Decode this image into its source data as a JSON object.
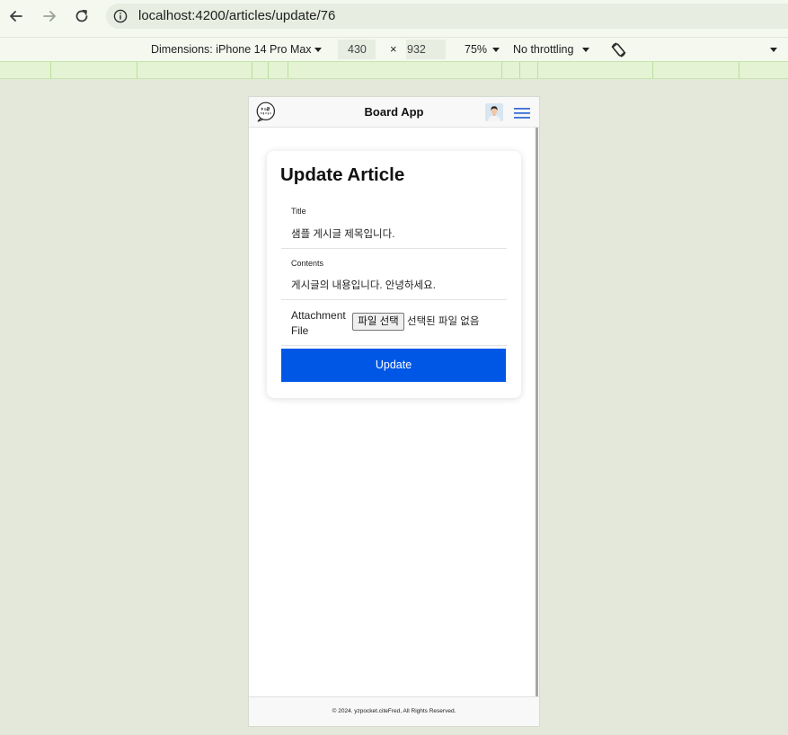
{
  "browser": {
    "back_icon": "arrow-left-icon",
    "forward_icon": "arrow-right-icon",
    "reload_icon": "reload-icon",
    "site_info_icon": "info-icon",
    "url": "localhost:4200/articles/update/76"
  },
  "device_toolbar": {
    "dimensions_label": "Dimensions: iPhone 14 Pro Max",
    "width": "430",
    "separator": "×",
    "height": "932",
    "zoom": "75%",
    "throttling": "No throttling",
    "rotate_icon": "rotate-icon",
    "more_icon": "chevron-down-icon"
  },
  "app": {
    "header": {
      "title": "Board App",
      "logo_icon": "speech-bubble-logo",
      "avatar": "user-avatar",
      "menu_icon": "hamburger-menu-icon"
    },
    "article_form": {
      "heading": "Update Article",
      "title_label": "Title",
      "title_value": "샘플 게시글 제목입니다.",
      "contents_label": "Contents",
      "contents_value": "게시글의 내용입니다. 안녕하세요.",
      "attachment_label": "Attachment File",
      "file_button_label": "파일 선택",
      "file_status": "선택된 파일 없음",
      "submit_label": "Update"
    },
    "footer": {
      "copyright": "© 2024. yzpocket.citeFred, All Rights Reserved."
    }
  },
  "colors": {
    "page_background": "#e3e8da",
    "accent_button": "#0057e6",
    "menu_icon": "#3a6fd8"
  }
}
